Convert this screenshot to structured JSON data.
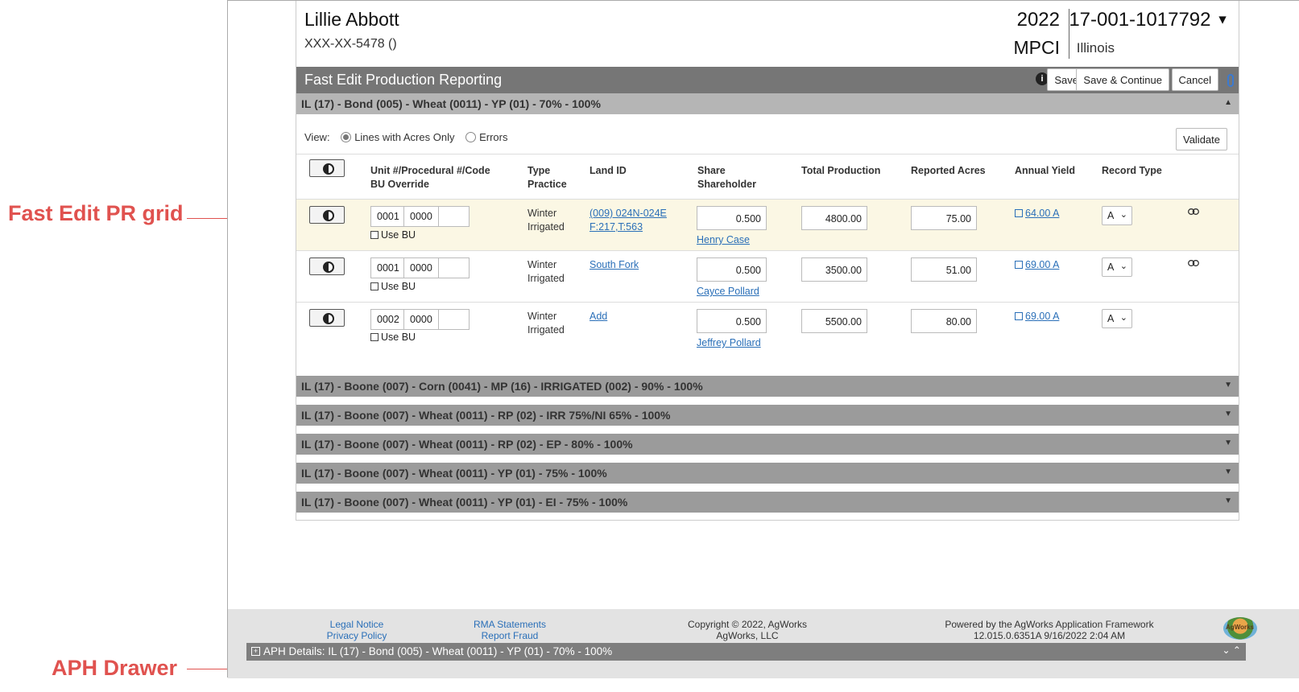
{
  "annotations": {
    "grid_label": "Fast Edit PR grid",
    "drawer_label": "APH Drawer",
    "color": "#e0524f"
  },
  "header": {
    "name": "Lillie Abbott",
    "ssn": "XXX-XX-5478 ()",
    "year": "2022",
    "program": "MPCI",
    "policy": "17-001-1017792",
    "state": "Illinois"
  },
  "titlebar": {
    "title": "Fast Edit Production Reporting",
    "save": "Save",
    "save_continue": "Save & Continue",
    "cancel": "Cancel"
  },
  "groups": {
    "active": "IL (17) - Bond (005) - Wheat (0011) - YP (01) - 70% - 100%",
    "collapsed": [
      "IL (17) - Boone (007) - Corn (0041) - MP (16) - IRRIGATED (002) - 90% - 100%",
      "IL (17) - Boone (007) - Wheat (0011) - RP (02) - IRR 75%/NI 65% - 100%",
      "IL (17) - Boone (007) - Wheat (0011) - RP (02) - EP - 80% - 100%",
      "IL (17) - Boone (007) - Wheat (0011) - YP (01) - 75% - 100%",
      "IL (17) - Boone (007) - Wheat (0011) - YP (01) - EI - 75% - 100%"
    ]
  },
  "view": {
    "label": "View:",
    "opt_lines": "Lines with Acres Only",
    "opt_errors": "Errors",
    "validate": "Validate"
  },
  "columns": {
    "unit1": "Unit #/Procedural #/Code",
    "unit2": "BU Override",
    "type1": "Type",
    "type2": "Practice",
    "land": "Land ID",
    "share1": "Share",
    "share2": "Shareholder",
    "total": "Total Production",
    "acres": "Reported Acres",
    "yield": "Annual Yield",
    "record": "Record Type"
  },
  "rows": [
    {
      "unit": "0001",
      "proc": "0000",
      "code": "",
      "use_bu": "Use BU",
      "type": "Winter",
      "practice": "Irrigated",
      "land1": "(009) 024N-024E",
      "land2": "F:217,T:563",
      "share": "0.500",
      "shareholder": "Henry Case",
      "total": "4800.00",
      "acres": "75.00",
      "yield": "64.00 A",
      "record": "A"
    },
    {
      "unit": "0001",
      "proc": "0000",
      "code": "",
      "use_bu": "Use BU",
      "type": "Winter",
      "practice": "Irrigated",
      "land1": "South Fork",
      "land2": "",
      "share": "0.500",
      "shareholder": "Cayce Pollard",
      "total": "3500.00",
      "acres": "51.00",
      "yield": "69.00 A",
      "record": "A"
    },
    {
      "unit": "0002",
      "proc": "0000",
      "code": "",
      "use_bu": "Use BU",
      "type": "Winter",
      "practice": "Irrigated",
      "land1": "Add",
      "land2": "",
      "share": "0.500",
      "shareholder": "Jeffrey Pollard",
      "total": "5500.00",
      "acres": "80.00",
      "yield": "69.00 A",
      "record": "A"
    }
  ],
  "footer": {
    "legal": "Legal Notice",
    "privacy": "Privacy Policy",
    "rma": "RMA Statements",
    "fraud": "Report Fraud",
    "copyright": "Copyright © 2022, AgWorks",
    "company": "AgWorks, LLC",
    "powered": "Powered by the AgWorks Application Framework",
    "version": "12.015.0.6351A 9/16/2022 2:04 AM",
    "logo_text": "AgWorks"
  },
  "drawer": {
    "title": "APH Details: IL (17) - Bond (005) - Wheat (0011) - YP (01) - 70% - 100%"
  }
}
